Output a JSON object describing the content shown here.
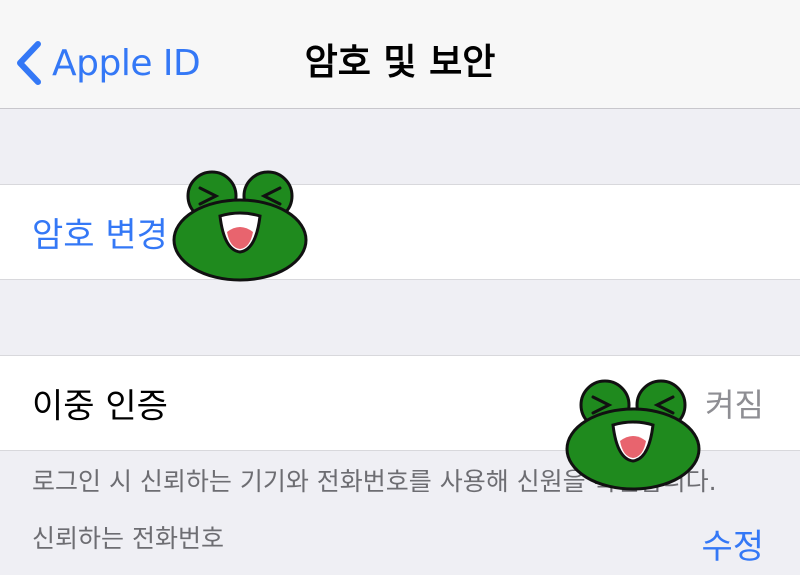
{
  "navbar": {
    "back_label": "Apple ID",
    "title": "암호 및 보안"
  },
  "password_cell": {
    "label": "암호 변경"
  },
  "two_factor_cell": {
    "label": "이중 인증",
    "value": "켜짐"
  },
  "two_factor_footnote": "로그인 시 신뢰하는 기기와 전화번호를 사용해 신원을 확인합니다.",
  "trusted_numbers": {
    "label": "신뢰하는 전화번호",
    "edit_label": "수정"
  },
  "icons": {
    "back": "chevron-left-icon",
    "sticker": "frog-sticker"
  },
  "colors": {
    "accent": "#3478f6",
    "background": "#efeff4",
    "secondary_text": "#6d6d72",
    "sticker_green": "#1f8a1e"
  }
}
